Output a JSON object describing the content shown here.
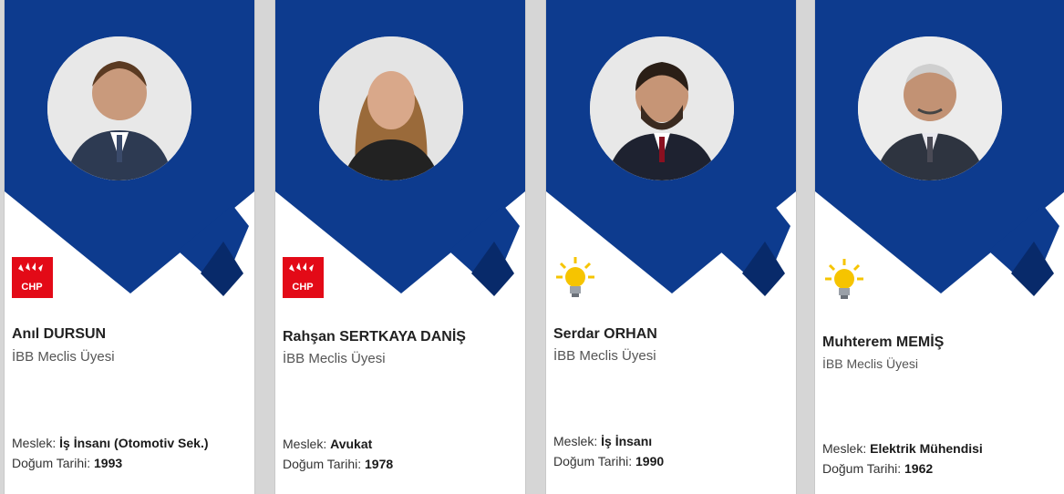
{
  "cards": [
    {
      "name": "Anıl DURSUN",
      "role": "İBB Meclis Üyesi",
      "occupation_label": "Meslek:",
      "occupation": "İş İnsanı (Otomotiv Sek.)",
      "birth_label": "Doğum Tarihi:",
      "birth_year": "1993",
      "party_icon": "chp-logo",
      "party_text": "CHP"
    },
    {
      "name": "Rahşan SERTKAYA DANİŞ",
      "role": "İBB Meclis Üyesi",
      "occupation_label": "Meslek:",
      "occupation": "Avukat",
      "birth_label": "Doğum Tarihi:",
      "birth_year": "1978",
      "party_icon": "chp-logo",
      "party_text": "CHP"
    },
    {
      "name": "Serdar ORHAN",
      "role": "İBB Meclis Üyesi",
      "occupation_label": "Meslek:",
      "occupation": "İş İnsanı",
      "birth_label": "Doğum Tarihi:",
      "birth_year": "1990",
      "party_icon": "lightbulb-logo"
    },
    {
      "name": "Muhterem MEMİŞ",
      "role": "İBB Meclis Üyesi",
      "occupation_label": "Meslek:",
      "occupation": "Elektrik Mühendisi",
      "birth_label": "Doğum Tarihi:",
      "birth_year": "1962",
      "party_icon": "lightbulb-logo"
    }
  ],
  "colors": {
    "banner": "#0d3b8e",
    "banner_dark": "#082a6a",
    "chp_red": "#e30a17",
    "akp_yellow": "#f6c400"
  }
}
